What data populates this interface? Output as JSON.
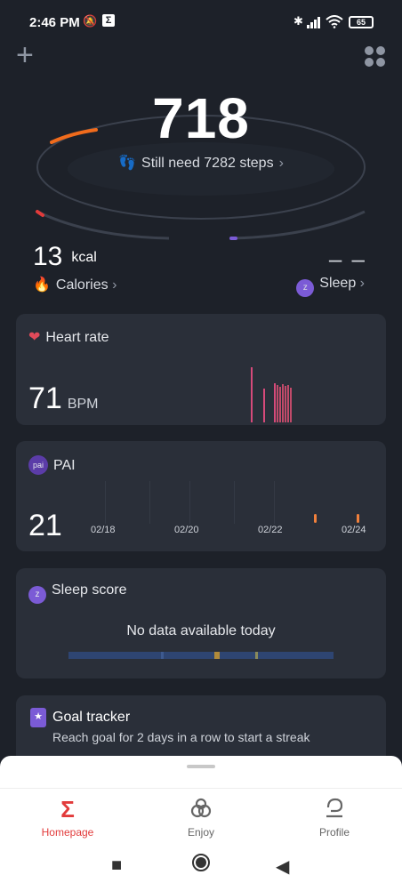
{
  "status": {
    "time": "2:46 PM",
    "battery": "65"
  },
  "hero": {
    "steps": "718",
    "still_need": "Still need 7282 steps"
  },
  "calories": {
    "value": "13",
    "unit": "kcal",
    "label": "Calories"
  },
  "sleep": {
    "value": "– –",
    "label": "Sleep"
  },
  "heart_card": {
    "title": "Heart rate",
    "value": "71",
    "unit": "BPM"
  },
  "pai_card": {
    "badge": "pai",
    "title": "PAI",
    "value": "21",
    "dates": [
      "02/18",
      "02/20",
      "02/22",
      "02/24"
    ]
  },
  "sleep_card": {
    "title": "Sleep score",
    "message": "No data available today"
  },
  "goal_card": {
    "title": "Goal tracker",
    "subtitle": "Reach goal for 2 days in a row to start a streak"
  },
  "tabs": [
    {
      "label": "Homepage",
      "icon": "sigma-icon",
      "active": true
    },
    {
      "label": "Enjoy",
      "icon": "infinity-icon",
      "active": false
    },
    {
      "label": "Profile",
      "icon": "profile-icon",
      "active": false
    }
  ],
  "colors": {
    "accent": "#e23b3b",
    "orange": "#f0803c",
    "purple": "#7b5bd6",
    "heart": "#e04a5a"
  }
}
